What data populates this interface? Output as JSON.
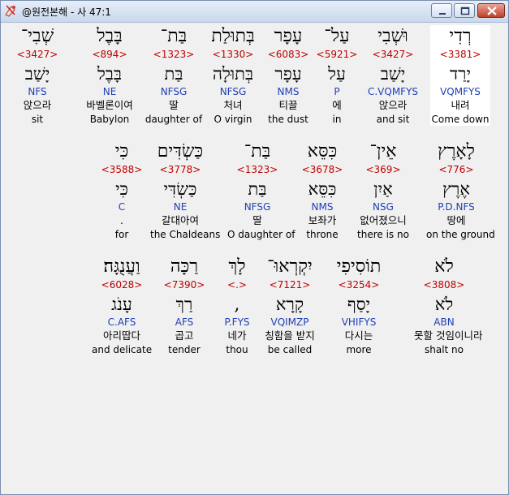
{
  "window": {
    "title": "@원전본해 - 사 47:1"
  },
  "rows": [
    [
      {
        "heb": "רְדִי",
        "strong": "<3381>",
        "lex": "יָרַד",
        "morph": "VQMFYS",
        "kor": "내려",
        "eng": "Come down",
        "selected": true
      },
      {
        "heb": "וּשְׁבִי",
        "strong": "<3427>",
        "lex": "יָשַׁב",
        "morph": "C.VQMFYS",
        "kor": "앉으라",
        "eng": "and sit"
      },
      {
        "heb": "עַל־",
        "strong": "<5921>",
        "lex": "עַל",
        "morph": "P",
        "kor": "에",
        "eng": "in"
      },
      {
        "heb": "עָפָר",
        "strong": "<6083>",
        "lex": "עָפָר",
        "morph": "NMS",
        "kor": "티끌",
        "eng": "the dust"
      },
      {
        "heb": "בְּתוּלַת",
        "strong": "<1330>",
        "lex": "בְּתוּלָה",
        "morph": "NFSG",
        "kor": "처녀",
        "eng": "O virgin"
      },
      {
        "heb": "בַּת־",
        "strong": "<1323>",
        "lex": "בַּת",
        "morph": "NFSG",
        "kor": "딸",
        "eng": "daughter of"
      },
      {
        "heb": "בָּבֶל",
        "strong": "<894>",
        "lex": "בָּבֶל",
        "morph": "NE",
        "kor": "바벨론이여",
        "eng": "Babylon"
      },
      {
        "heb": "שְׁבִי־",
        "strong": "<3427>",
        "lex": "יָשַׁב",
        "morph": "NFS",
        "kor": "앉으라",
        "eng": "sit"
      }
    ],
    [
      {
        "heb": "לָאָרֶץ",
        "strong": "<776>",
        "lex": "אֶרֶץ",
        "morph": "P.D.NFS",
        "kor": "땅에",
        "eng": "on the ground"
      },
      {
        "heb": "אֵין־",
        "strong": "<369>",
        "lex": "אַיִן",
        "morph": "NSG",
        "kor": "없어졌으니",
        "eng": "there is no"
      },
      {
        "heb": "כִּסֵּא",
        "strong": "<3678>",
        "lex": "כִּסֵּא",
        "morph": "NMS",
        "kor": "보좌가",
        "eng": "throne"
      },
      {
        "heb": "בַּת־",
        "strong": "<1323>",
        "lex": "בַּת",
        "morph": "NFSG",
        "kor": "딸",
        "eng": "O daughter of"
      },
      {
        "heb": "כַּשְׂדִּים",
        "strong": "<3778>",
        "lex": "כַּשְׂדִּי",
        "morph": "NE",
        "kor": "갈대아여",
        "eng": "the Chaldeans"
      },
      {
        "heb": "כִּי",
        "strong": "<3588>",
        "lex": "כִּי",
        "morph": "C",
        "kor": ".",
        "eng": "for"
      }
    ],
    [
      {
        "heb": "לֹא",
        "strong": "<3808>",
        "lex": "לֹא",
        "morph": "ABN",
        "kor": "못할 것임이니라",
        "eng": "shalt no"
      },
      {
        "heb": "תוֹסִיפִי",
        "strong": "<3254>",
        "lex": "יָסַף",
        "morph": "VHIFYS",
        "kor": "다시는",
        "eng": "more"
      },
      {
        "heb": "יִקְרְאוּ־",
        "strong": "<7121>",
        "lex": "קָרָא",
        "morph": "VQIMZP",
        "kor": "칭함을 받지",
        "eng": "be called"
      },
      {
        "heb": "לָךְ",
        "strong": "<.>",
        "lex": ",",
        "morph": "P.FYS",
        "kor": "네가",
        "eng": "thou"
      },
      {
        "heb": "רַכָּה",
        "strong": "<7390>",
        "lex": "רַךְ",
        "morph": "AFS",
        "kor": "곱고",
        "eng": "tender"
      },
      {
        "heb": "וַעֲנֻגָּה׃",
        "strong": "<6028>",
        "lex": "עָנֹג",
        "morph": "C.AFS",
        "kor": "아리땁다",
        "eng": "and delicate"
      }
    ]
  ]
}
